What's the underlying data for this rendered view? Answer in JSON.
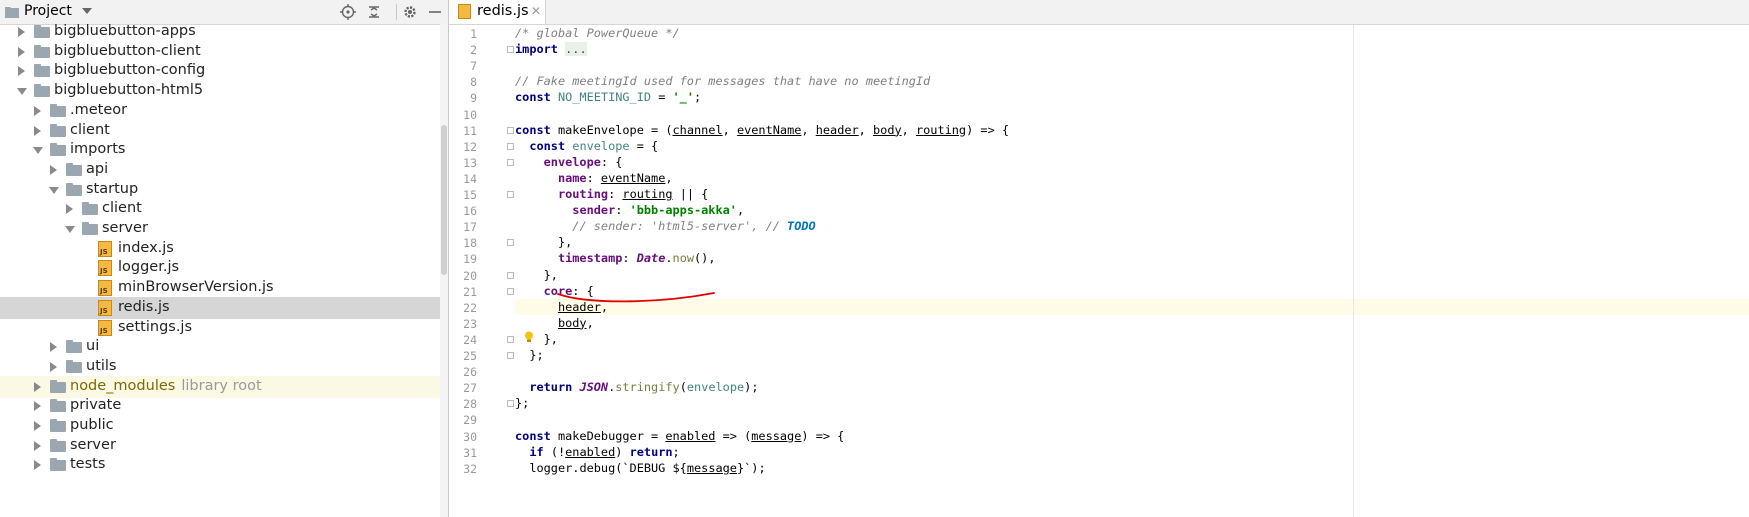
{
  "project_panel": {
    "title": "Project",
    "icons": [
      "locate-icon",
      "collapse-all-icon",
      "settings-gear-icon",
      "hide-panel-icon"
    ],
    "tree": [
      {
        "label": "bigbluebutton-apps",
        "type": "folder",
        "depth": 1,
        "expanded": false
      },
      {
        "label": "bigbluebutton-client",
        "type": "folder",
        "depth": 1,
        "expanded": false
      },
      {
        "label": "bigbluebutton-config",
        "type": "folder",
        "depth": 1,
        "expanded": false
      },
      {
        "label": "bigbluebutton-html5",
        "type": "folder",
        "depth": 1,
        "expanded": true
      },
      {
        "label": ".meteor",
        "type": "folder",
        "depth": 2,
        "expanded": false
      },
      {
        "label": "client",
        "type": "folder",
        "depth": 2,
        "expanded": false
      },
      {
        "label": "imports",
        "type": "folder",
        "depth": 2,
        "expanded": true
      },
      {
        "label": "api",
        "type": "folder",
        "depth": 3,
        "expanded": false
      },
      {
        "label": "startup",
        "type": "folder",
        "depth": 3,
        "expanded": true
      },
      {
        "label": "client",
        "type": "folder",
        "depth": 4,
        "expanded": false
      },
      {
        "label": "server",
        "type": "folder",
        "depth": 4,
        "expanded": true
      },
      {
        "label": "index.js",
        "type": "js",
        "depth": 5
      },
      {
        "label": "logger.js",
        "type": "js",
        "depth": 5
      },
      {
        "label": "minBrowserVersion.js",
        "type": "js",
        "depth": 5
      },
      {
        "label": "redis.js",
        "type": "js",
        "depth": 5,
        "selected": true
      },
      {
        "label": "settings.js",
        "type": "js",
        "depth": 5
      },
      {
        "label": "ui",
        "type": "folder",
        "depth": 3,
        "expanded": false
      },
      {
        "label": "utils",
        "type": "folder",
        "depth": 3,
        "expanded": false
      },
      {
        "label": "node_modules",
        "suffix": "library root",
        "type": "folder",
        "depth": 2,
        "expanded": false,
        "excluded": true
      },
      {
        "label": "private",
        "type": "folder",
        "depth": 2,
        "expanded": false
      },
      {
        "label": "public",
        "type": "folder",
        "depth": 2,
        "expanded": false
      },
      {
        "label": "server",
        "type": "folder",
        "depth": 2,
        "expanded": false
      },
      {
        "label": "tests",
        "type": "folder",
        "depth": 2,
        "expanded": false
      }
    ]
  },
  "editor": {
    "tab": {
      "label": "redis.js",
      "close": "✕"
    },
    "current_line": 22,
    "lines": [
      {
        "n": "1",
        "t": [
          [
            "cm",
            "/* global PowerQueue */"
          ]
        ]
      },
      {
        "n": "2",
        "t": [
          [
            "kw",
            "import "
          ],
          [
            "fold-marker",
            "..."
          ]
        ]
      },
      {
        "n": "7",
        "t": []
      },
      {
        "n": "8",
        "t": [
          [
            "cm",
            "// Fake meetingId used for messages that have no meetingId"
          ]
        ]
      },
      {
        "n": "9",
        "t": [
          [
            "kw",
            "const "
          ],
          [
            "var",
            "NO_MEETING_ID"
          ],
          [
            "",
            " = "
          ],
          [
            "str",
            "'_'"
          ],
          [
            "",
            ";"
          ]
        ]
      },
      {
        "n": "10",
        "t": []
      },
      {
        "n": "11",
        "t": [
          [
            "kw",
            "const "
          ],
          [
            "",
            "makeEnvelope = ("
          ],
          [
            "param",
            "channel"
          ],
          [
            "",
            ", "
          ],
          [
            "param",
            "eventName"
          ],
          [
            "",
            ", "
          ],
          [
            "param",
            "header"
          ],
          [
            "",
            ", "
          ],
          [
            "param",
            "body"
          ],
          [
            "",
            ", "
          ],
          [
            "param",
            "routing"
          ],
          [
            "",
            ") => {"
          ]
        ]
      },
      {
        "n": "12",
        "t": [
          [
            "",
            "  "
          ],
          [
            "kw",
            "const "
          ],
          [
            "var",
            "envelope"
          ],
          [
            "",
            " = {"
          ]
        ]
      },
      {
        "n": "13",
        "t": [
          [
            "",
            "    "
          ],
          [
            "prop",
            "envelope"
          ],
          [
            "",
            ": {"
          ]
        ]
      },
      {
        "n": "14",
        "t": [
          [
            "",
            "      "
          ],
          [
            "prop",
            "name"
          ],
          [
            "",
            ": "
          ],
          [
            "param",
            "eventName"
          ],
          [
            "",
            ","
          ]
        ]
      },
      {
        "n": "15",
        "t": [
          [
            "",
            "      "
          ],
          [
            "prop",
            "routing"
          ],
          [
            "",
            ": "
          ],
          [
            "param",
            "routing"
          ],
          [
            "",
            " || {"
          ]
        ]
      },
      {
        "n": "16",
        "t": [
          [
            "",
            "        "
          ],
          [
            "prop",
            "sender"
          ],
          [
            "",
            ": "
          ],
          [
            "str",
            "'bbb-apps-akka'"
          ],
          [
            "",
            ","
          ]
        ]
      },
      {
        "n": "17",
        "t": [
          [
            "",
            "        "
          ],
          [
            "cm",
            "// sender: 'html5-server', // "
          ],
          [
            "todo",
            "TODO"
          ]
        ]
      },
      {
        "n": "18",
        "t": [
          [
            "",
            "      },"
          ]
        ]
      },
      {
        "n": "19",
        "t": [
          [
            "",
            "      "
          ],
          [
            "prop",
            "timestamp"
          ],
          [
            "",
            ": "
          ],
          [
            "glob",
            "Date"
          ],
          [
            "",
            "."
          ],
          [
            "fn",
            "now"
          ],
          [
            "",
            "(),"
          ]
        ]
      },
      {
        "n": "20",
        "t": [
          [
            "",
            "    },"
          ]
        ]
      },
      {
        "n": "21",
        "t": [
          [
            "",
            "    "
          ],
          [
            "prop",
            "core"
          ],
          [
            "",
            ": {"
          ]
        ]
      },
      {
        "n": "22",
        "t": [
          [
            "",
            "      "
          ],
          [
            "param",
            "header"
          ],
          [
            "",
            ","
          ]
        ]
      },
      {
        "n": "23",
        "t": [
          [
            "",
            "      "
          ],
          [
            "param",
            "body"
          ],
          [
            "",
            ","
          ]
        ]
      },
      {
        "n": "24",
        "t": [
          [
            "",
            "    },"
          ]
        ]
      },
      {
        "n": "25",
        "t": [
          [
            "",
            "  };"
          ]
        ]
      },
      {
        "n": "26",
        "t": []
      },
      {
        "n": "27",
        "t": [
          [
            "",
            "  "
          ],
          [
            "kw",
            "return "
          ],
          [
            "glob",
            "JSON"
          ],
          [
            "",
            "."
          ],
          [
            "fn",
            "stringify"
          ],
          [
            "",
            "("
          ],
          [
            "var",
            "envelope"
          ],
          [
            "",
            ");"
          ]
        ]
      },
      {
        "n": "28",
        "t": [
          [
            "",
            "};"
          ]
        ]
      },
      {
        "n": "29",
        "t": []
      },
      {
        "n": "30",
        "t": [
          [
            "kw",
            "const "
          ],
          [
            "",
            "makeDebugger = "
          ],
          [
            "param",
            "enabled"
          ],
          [
            "",
            " => ("
          ],
          [
            "param",
            "message"
          ],
          [
            "",
            ") => {"
          ]
        ]
      },
      {
        "n": "31",
        "t": [
          [
            "",
            "  "
          ],
          [
            "kw",
            "if "
          ],
          [
            "",
            "(!"
          ],
          [
            "param",
            "enabled"
          ],
          [
            "",
            ") "
          ],
          [
            "kw",
            "return"
          ],
          [
            "",
            ";"
          ]
        ]
      },
      {
        "n": "32",
        "t": [
          [
            "",
            "  "
          ],
          [
            "",
            "logger.debug(`DEBUG "
          ],
          [
            "",
            "${"
          ],
          [
            "param",
            "message"
          ],
          [
            "",
            "}`);"
          ]
        ]
      }
    ],
    "fold_markers_lines": [
      "2",
      "11",
      "12",
      "13",
      "15",
      "18",
      "20",
      "21",
      "24",
      "25",
      "28"
    ],
    "annotation_color": "#e00000"
  }
}
